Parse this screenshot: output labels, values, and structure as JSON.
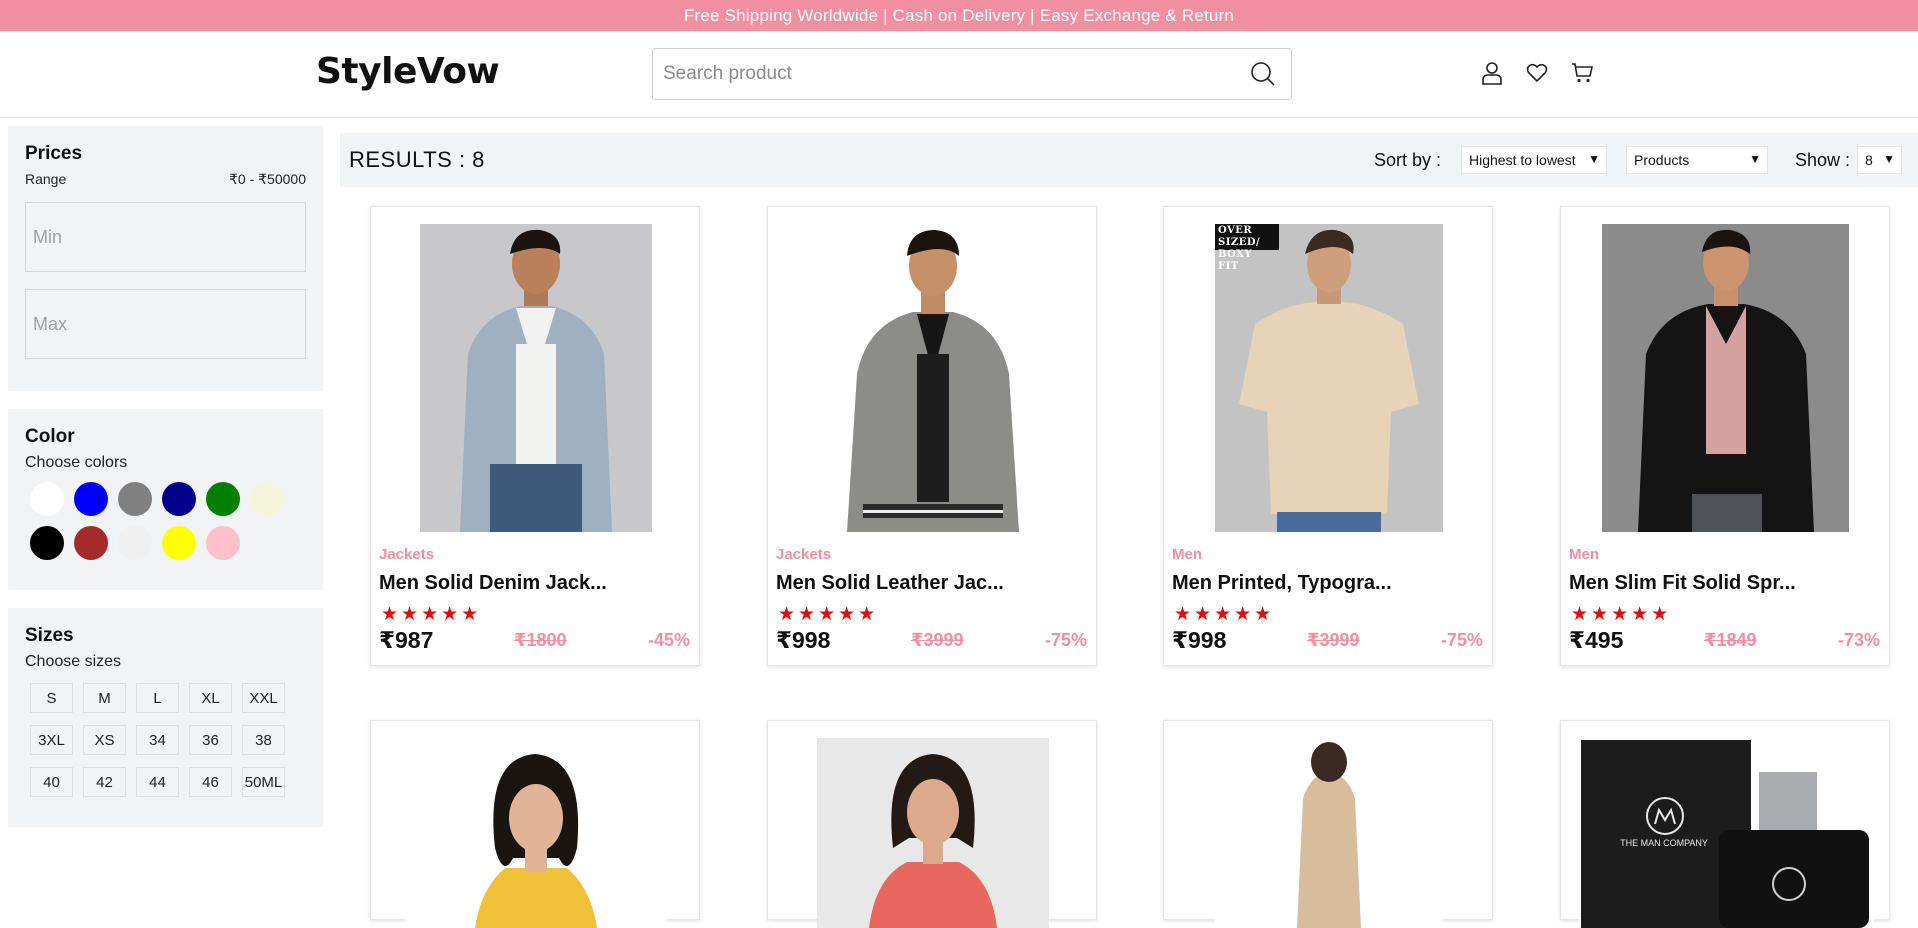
{
  "announcement": "Free Shipping Worldwide | Cash on Delivery | Easy Exchange & Return",
  "brand": "StyleVow",
  "search": {
    "placeholder": "Search product"
  },
  "header_icons": [
    "user-icon",
    "heart-icon",
    "cart-icon"
  ],
  "filters": {
    "prices": {
      "title": "Prices",
      "range_label": "Range",
      "range_value": "₹0 - ₹50000",
      "min_placeholder": "Min",
      "max_placeholder": "Max"
    },
    "color": {
      "title": "Color",
      "subtitle": "Choose colors",
      "swatches": [
        "#ffffff",
        "#0000ff",
        "#808080",
        "#00008b",
        "#008000",
        "#f5f5dc",
        "#000000",
        "#a52a2a",
        "#f0f0f0",
        "#ffff00",
        "#ffc0cb"
      ]
    },
    "sizes": {
      "title": "Sizes",
      "subtitle": "Choose sizes",
      "options": [
        "S",
        "M",
        "L",
        "XL",
        "XXL",
        "3XL",
        "XS",
        "34",
        "36",
        "38",
        "40",
        "42",
        "44",
        "46",
        "50ML"
      ]
    }
  },
  "results": {
    "label": "RESULTS : 8",
    "sort_label": "Sort by :",
    "sort_value": "Highest to lowest",
    "category_value": "Products",
    "show_label": "Show :",
    "show_value": "8"
  },
  "products": [
    {
      "category": "Jackets",
      "name": "Men Solid Denim Jack...",
      "rating": 5,
      "price": "₹987",
      "mrp": "₹1800",
      "discount": "-45%"
    },
    {
      "category": "Jackets",
      "name": "Men Solid Leather Jac...",
      "rating": 5,
      "price": "₹998",
      "mrp": "₹3999",
      "discount": "-75%"
    },
    {
      "category": "Men",
      "name": "Men Printed, Typogra...",
      "rating": 5,
      "price": "₹998",
      "mrp": "₹3999",
      "discount": "-75%",
      "badge": "OVER SIZED/ BOXY FIT"
    },
    {
      "category": "Men",
      "name": "Men Slim Fit Solid Spr...",
      "rating": 5,
      "price": "₹495",
      "mrp": "₹1849",
      "discount": "-73%"
    }
  ],
  "second_row": {
    "perfume_brand": "THE MAN COMPANY"
  }
}
